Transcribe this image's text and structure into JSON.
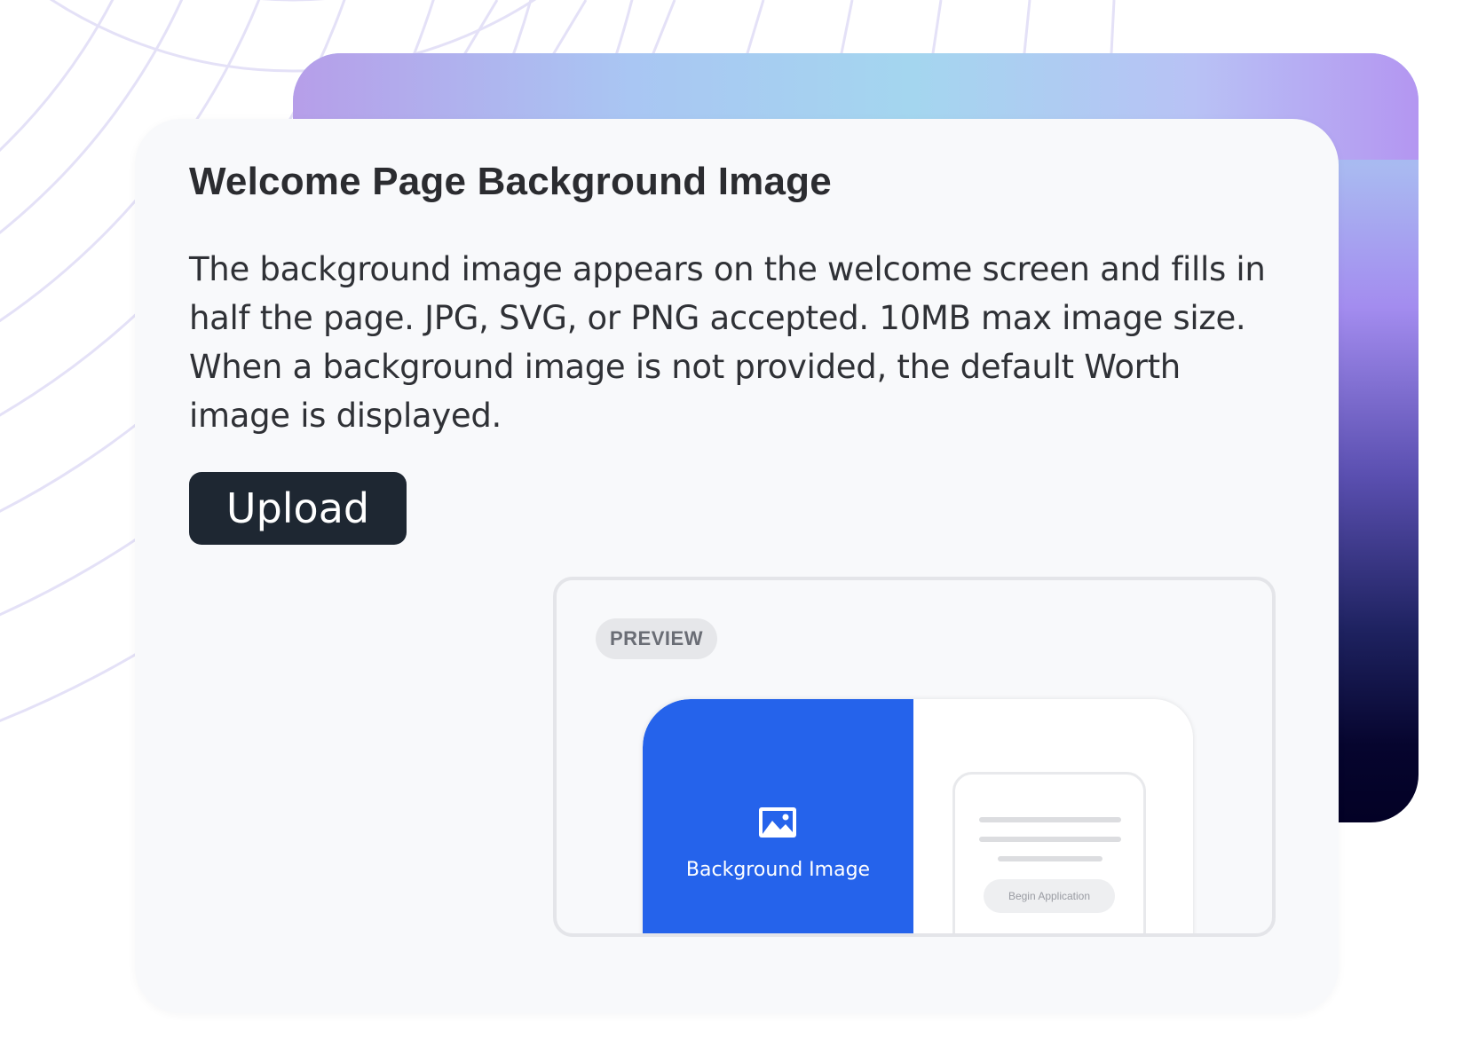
{
  "card": {
    "title": "Welcome Page Background Image",
    "description": "The background image appears on the welcome screen and fills in half the page. JPG, SVG, or PNG accepted. 10MB max image size. When a background image is not provided, the default Worth image is displayed.",
    "upload_label": "Upload"
  },
  "preview": {
    "badge": "PREVIEW",
    "image_label": "Background Image",
    "image_icon": "image-icon",
    "form_button_label": "Begin Application"
  },
  "colors": {
    "accent_blue": "#2563eb",
    "button_dark": "#1e2732",
    "card_background": "#f8f9fb"
  }
}
